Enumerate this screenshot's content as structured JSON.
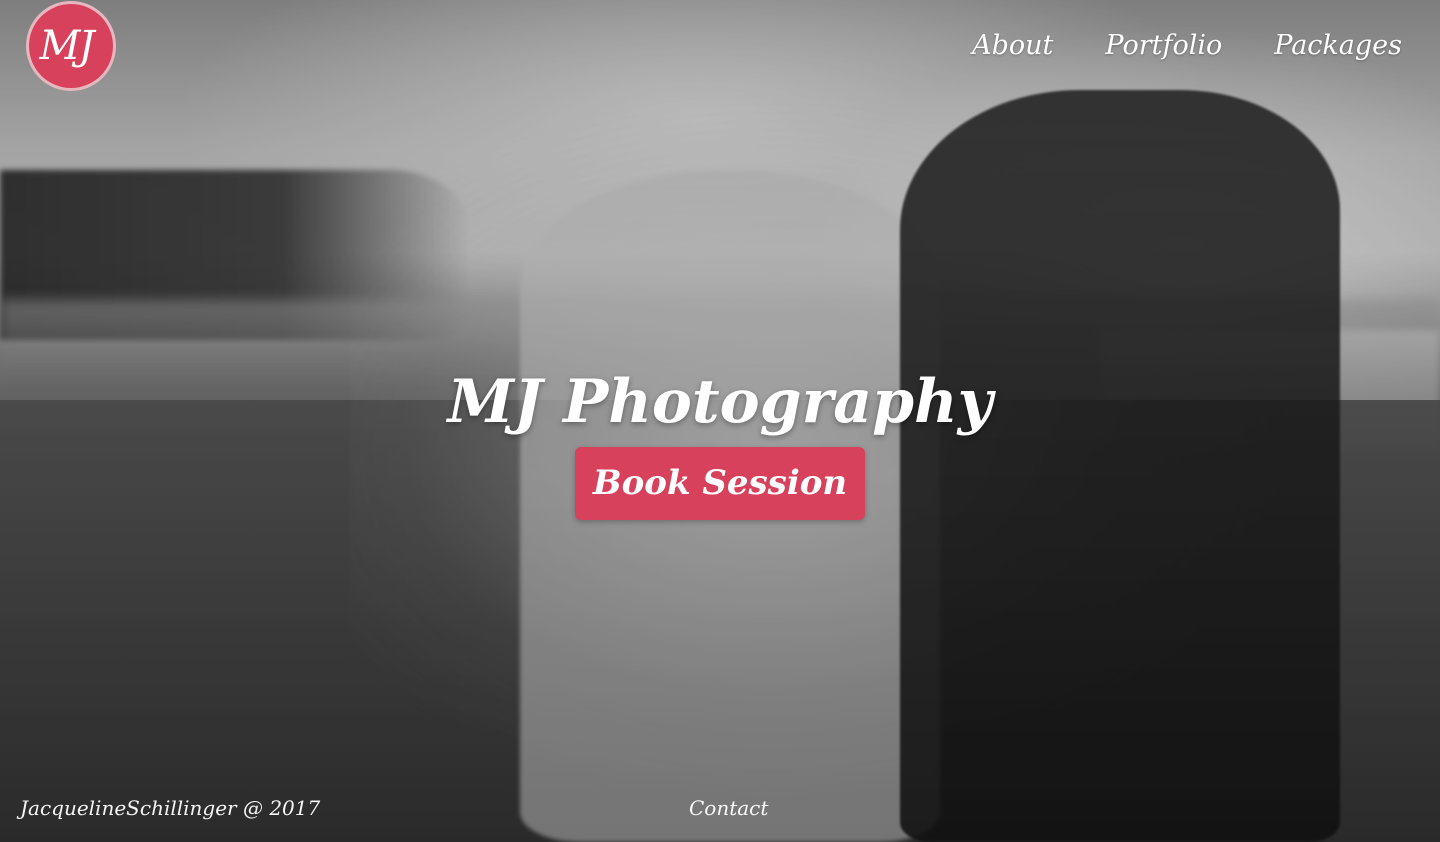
{
  "brand": {
    "logo_text": "MJ",
    "logo_color": "#d8415b"
  },
  "nav": {
    "items": [
      {
        "label": "About"
      },
      {
        "label": "Portfolio"
      },
      {
        "label": "Packages"
      }
    ]
  },
  "hero": {
    "title": "MJ Photography",
    "cta_label": "Book Session",
    "accent_color": "#d8415b"
  },
  "footer": {
    "credit": "JacquelineSchillinger @ 2017",
    "contact_label": "Contact"
  }
}
